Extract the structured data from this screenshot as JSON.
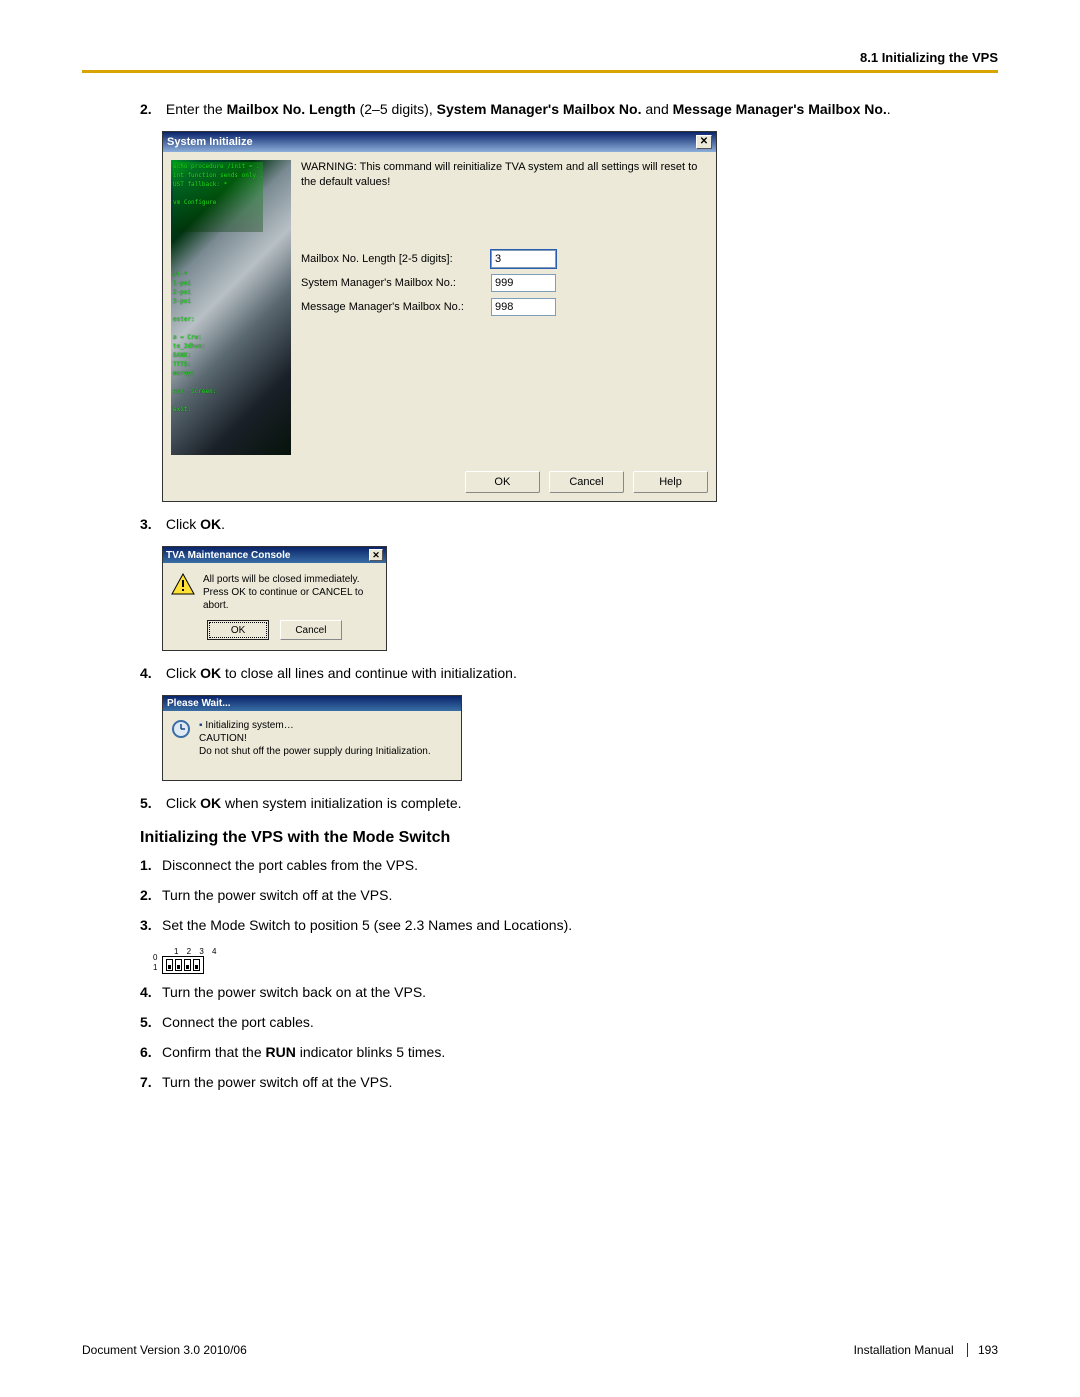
{
  "header": {
    "section": "8.1 Initializing the VPS"
  },
  "steps": {
    "s2": {
      "num": "2.",
      "p1": "Enter the ",
      "b1": "Mailbox No. Length",
      "p2": " (2–5 digits), ",
      "b2": "System Manager's Mailbox No.",
      "p3": " and ",
      "b3": "Message Manager's Mailbox No.",
      "p4": "."
    },
    "s3": {
      "num": "3.",
      "p1": "Click ",
      "b1": "OK",
      "p2": "."
    },
    "s4": {
      "num": "4.",
      "p1": "Click ",
      "b1": "OK",
      "p2": " to close all lines and continue with initialization."
    },
    "s5": {
      "num": "5.",
      "p1": "Click ",
      "b1": "OK",
      "p2": " when system initialization is complete."
    }
  },
  "dlg1": {
    "title": "System Initialize",
    "warning": "WARNING: This command will reinitialize TVA system and all settings will reset to the default values!",
    "row1_label": "Mailbox No. Length [2-5 digits]:",
    "row1_value": "3",
    "row2_label": "System Manager's Mailbox No.:",
    "row2_value": "999",
    "row3_label": "Message Manager's Mailbox No.:",
    "row3_value": "998",
    "ok": "OK",
    "cancel": "Cancel",
    "help": "Help",
    "termtxt": "echo procedure /init = .\nint function sends only :\nUST fallback: *\n\nvm Configure\n\n\n\n\n\n\n\nvt-*\n1-poi\n2-poi\n3-poi\n\nester:\n\na = Crw:\nte_2dhvn:\nBANK:\nTTTS:\nmorey:\n\nesx, Screen:\n\nexit:"
  },
  "dlg2": {
    "title": "TVA Maintenance Console",
    "line1": "All ports will be closed immediately.",
    "line2": "Press OK to continue or CANCEL to abort.",
    "ok": "OK",
    "cancel": "Cancel"
  },
  "dlg3": {
    "title": "Please Wait...",
    "bullet": "Initializing system…",
    "caution_h": "CAUTION!",
    "caution_t": "Do not shut off the power supply during Initialization."
  },
  "h2": "Initializing the VPS with the Mode Switch",
  "mode_steps": {
    "m1": {
      "num": "1.",
      "t": "Disconnect the port cables from the VPS."
    },
    "m2": {
      "num": "2.",
      "t": "Turn the power switch off at the VPS."
    },
    "m3": {
      "num": "3.",
      "t": "Set the Mode Switch to position 5 (see 2.3  Names and Locations)."
    },
    "m4": {
      "num": "4.",
      "t": "Turn the power switch back on at the VPS."
    },
    "m5": {
      "num": "5.",
      "t": "Connect the port cables."
    },
    "m6": {
      "num": "6.",
      "p1": "Confirm that the ",
      "b1": "RUN",
      "p2": " indicator blinks 5 times."
    },
    "m7": {
      "num": "7.",
      "t": "Turn the power switch off at the VPS."
    }
  },
  "switch": {
    "top": "1 2 3 4",
    "zero": "0",
    "one": "1"
  },
  "footer": {
    "left": "Document Version  3.0  2010/06",
    "right1": "Installation Manual",
    "right2": "193"
  }
}
